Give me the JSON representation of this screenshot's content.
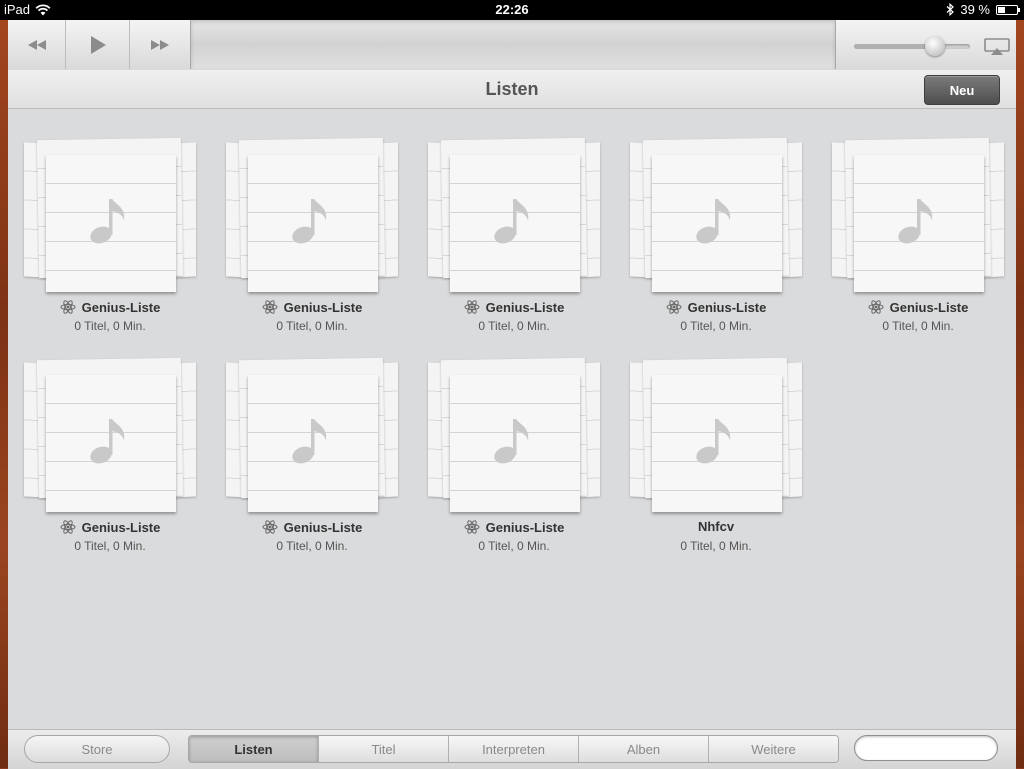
{
  "status_bar": {
    "device": "iPad",
    "time": "22:26",
    "battery": "39 %",
    "battery_level": 0.39
  },
  "player": {
    "volume_level": 0.7
  },
  "header": {
    "title": "Listen",
    "new_button": "Neu"
  },
  "playlists": [
    {
      "name": "Genius-Liste",
      "genius": true,
      "info": "0 Titel, 0 Min."
    },
    {
      "name": "Genius-Liste",
      "genius": true,
      "info": "0 Titel, 0 Min."
    },
    {
      "name": "Genius-Liste",
      "genius": true,
      "info": "0 Titel, 0 Min."
    },
    {
      "name": "Genius-Liste",
      "genius": true,
      "info": "0 Titel, 0 Min."
    },
    {
      "name": "Genius-Liste",
      "genius": true,
      "info": "0 Titel, 0 Min."
    },
    {
      "name": "Genius-Liste",
      "genius": true,
      "info": "0 Titel, 0 Min."
    },
    {
      "name": "Genius-Liste",
      "genius": true,
      "info": "0 Titel, 0 Min."
    },
    {
      "name": "Genius-Liste",
      "genius": true,
      "info": "0 Titel, 0 Min."
    },
    {
      "name": "Nhfcv",
      "genius": false,
      "info": "0 Titel, 0 Min."
    }
  ],
  "tab_bar": {
    "store": "Store",
    "tabs": [
      {
        "label": "Listen",
        "active": true
      },
      {
        "label": "Titel",
        "active": false
      },
      {
        "label": "Interpreten",
        "active": false
      },
      {
        "label": "Alben",
        "active": false
      },
      {
        "label": "Weitere",
        "active": false
      }
    ],
    "search_value": "",
    "search_placeholder": ""
  }
}
